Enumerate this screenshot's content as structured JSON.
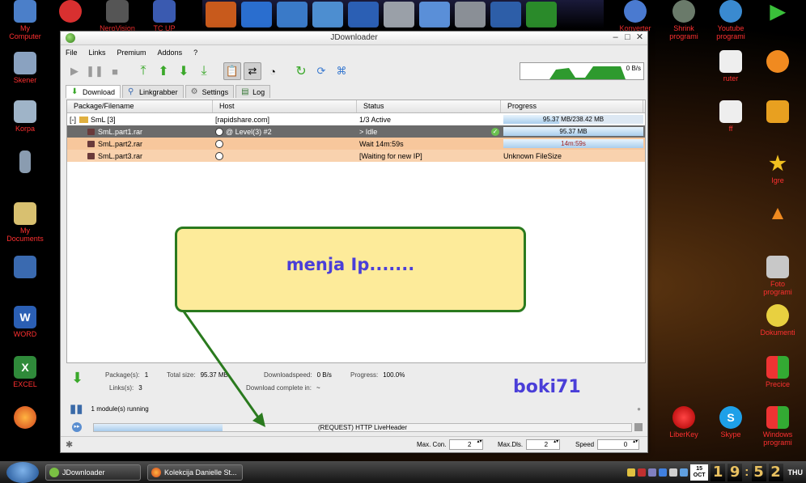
{
  "desktop": {
    "left_icons": [
      {
        "label": "My\nComputer"
      },
      {
        "label": "Skener"
      },
      {
        "label": "Korpa"
      },
      {
        "label": "My\nDocuments"
      },
      {
        "label": "WORD"
      },
      {
        "label": "EXCEL"
      }
    ],
    "top_icons": [
      {
        "label": "NeroVision"
      },
      {
        "label": "TC UP"
      }
    ],
    "right_icons": [
      {
        "label": "Konverter"
      },
      {
        "label": "Shrink\nprogrami"
      },
      {
        "label": "Youtube\nprogrami"
      },
      {
        "label": "ruter"
      },
      {
        "label": "ff"
      },
      {
        "label": "Igre"
      },
      {
        "label": "Foto\nprogrami"
      },
      {
        "label": "Dokumenti"
      },
      {
        "label": "Precice"
      },
      {
        "label": "LiberKey"
      },
      {
        "label": "Skype"
      },
      {
        "label": "Windows\nprogrami"
      }
    ]
  },
  "window": {
    "title": "JDownloader",
    "controls": {
      "minimize": "–",
      "maximize": "□",
      "close": "✕"
    }
  },
  "menu": [
    "File",
    "Links",
    "Premium",
    "Addons",
    "?"
  ],
  "speed_graph": {
    "label": "0 B/s"
  },
  "tabs": [
    {
      "label": "Download",
      "icon": "download-arrow-icon",
      "active": true
    },
    {
      "label": "Linkgrabber",
      "icon": "magnifier-icon",
      "active": false
    },
    {
      "label": "Settings",
      "icon": "gear-icon",
      "active": false
    },
    {
      "label": "Log",
      "icon": "log-icon",
      "active": false
    }
  ],
  "table": {
    "columns": [
      "Package/Filename",
      "Host",
      "Status",
      "Progress"
    ],
    "package": {
      "toggle": "[-]",
      "name": "SmL [3]",
      "host": "[rapidshare.com]",
      "status": "1/3 Active",
      "progress_text": "95.37 MB/238.42 MB",
      "progress_fraction": 0.4
    },
    "files": [
      {
        "name": "SmL.part1.rar",
        "host": "@ Level(3) #2",
        "status": "> Idle",
        "progress_text": "95.37 MB",
        "progress_fraction": 1.0,
        "state": "selected"
      },
      {
        "name": "SmL.part2.rar",
        "host": "",
        "status": "Wait 14m:59s",
        "progress_text": "14m:59s",
        "progress_fraction": 1.0,
        "state": "waiting"
      },
      {
        "name": "SmL.part3.rar",
        "host": "",
        "status": "[Waiting for new IP]",
        "progress_text": "Unknown FileSize",
        "progress_fraction": 0,
        "state": "waiting2"
      }
    ]
  },
  "info": {
    "packages_label": "Package(s):",
    "packages_value": "1",
    "links_label": "Links(s):",
    "links_value": "3",
    "totalsize_label": "Total size:",
    "totalsize_value": "95.37 MB",
    "dlspeed_label": "Downloadspeed:",
    "dlspeed_value": "0 B/s",
    "complete_label": "Download complete in:",
    "complete_value": "~",
    "progress_label": "Progress:",
    "progress_value": "100.0%"
  },
  "modules": {
    "text": "1 module(s) running"
  },
  "request_bar": {
    "text": "(REQUEST) HTTP LiveHeader",
    "progress_fraction": 0.24
  },
  "statusbar": {
    "maxcon_label": "Max. Con.",
    "maxcon_value": "2",
    "maxdls_label": "Max.Dls.",
    "maxdls_value": "2",
    "speed_label": "Speed",
    "speed_value": "0"
  },
  "annotation": {
    "callout_text": "menja Ip.......",
    "signature": "boki71"
  },
  "taskbar": {
    "tasks": [
      {
        "label": "JDownloader"
      },
      {
        "label": "Kolekcija Danielle St..."
      }
    ],
    "clock": {
      "date_day": "15",
      "date_month": "OCT",
      "h1": "1",
      "h2": "9",
      "m1": "5",
      "m2": "2",
      "dow": "THU"
    }
  }
}
